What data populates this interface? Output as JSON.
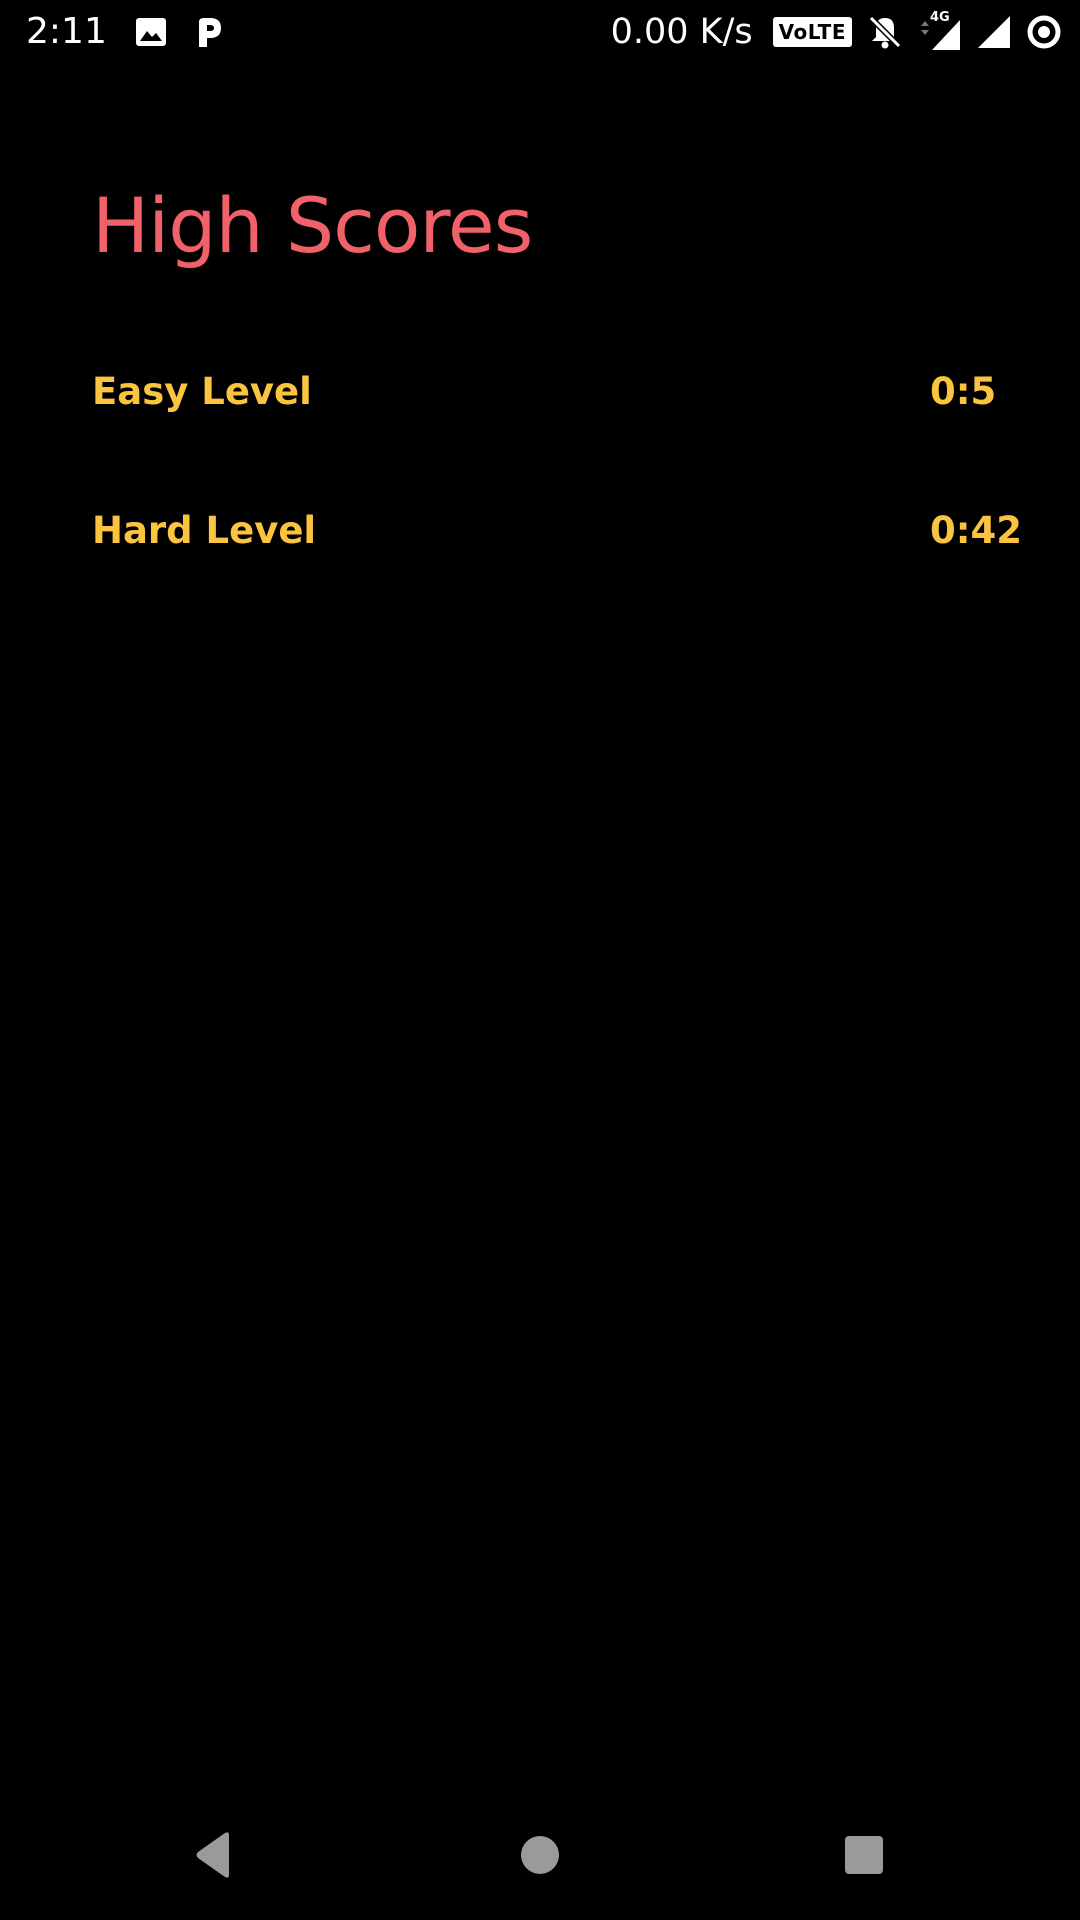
{
  "status_bar": {
    "time": "2:11",
    "net_speed": "0.00 K/s",
    "volte": "VoLTE",
    "network_type": "4G",
    "icons": [
      "image-icon",
      "p-app-icon",
      "volte-icon",
      "bell-off-icon",
      "data-arrows-icon",
      "signal-icon",
      "signal-icon",
      "ring-icon"
    ]
  },
  "page": {
    "title": "High Scores"
  },
  "scores": [
    {
      "label": "Easy Level",
      "value": "0:5"
    },
    {
      "label": "Hard Level",
      "value": "0:42"
    }
  ],
  "navigation": {
    "buttons": [
      "back",
      "home",
      "recents"
    ]
  },
  "colors": {
    "background": "#000000",
    "title": "#f0616a",
    "score_text": "#fbc440",
    "nav_buttons": "#9a9a9a"
  }
}
